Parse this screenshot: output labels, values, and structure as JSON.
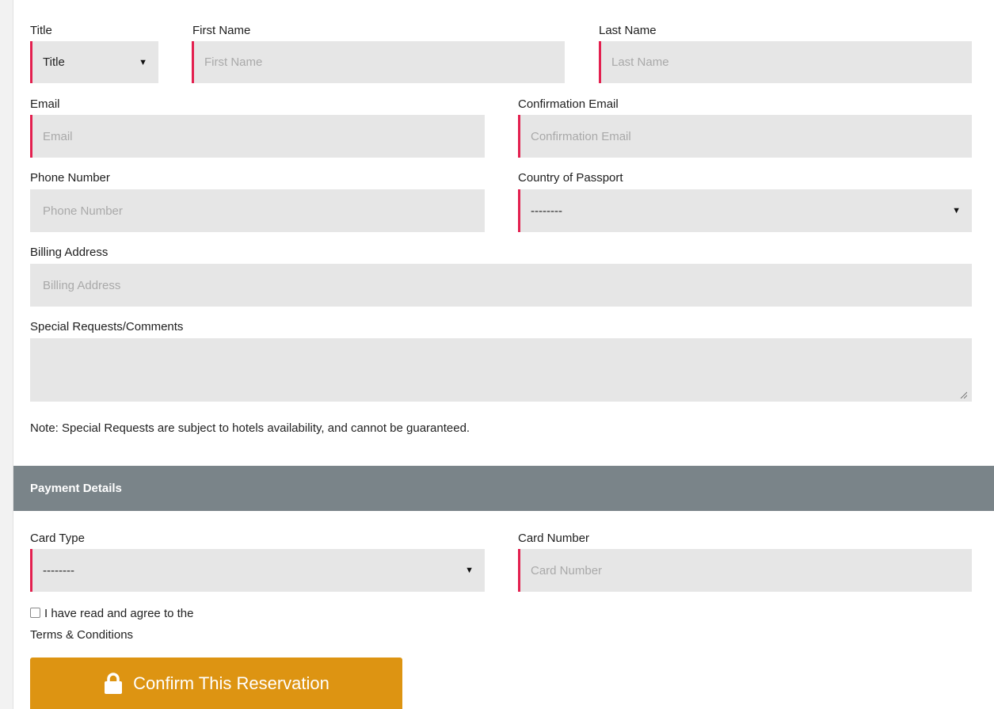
{
  "guest": {
    "title_label": "Title",
    "title_value": "Title",
    "first_name_label": "First Name",
    "first_name_placeholder": "First Name",
    "last_name_label": "Last Name",
    "last_name_placeholder": "Last Name",
    "email_label": "Email",
    "email_placeholder": "Email",
    "confirm_email_label": "Confirmation Email",
    "confirm_email_placeholder": "Confirmation Email",
    "phone_label": "Phone Number",
    "phone_placeholder": "Phone Number",
    "passport_label": "Country of Passport",
    "passport_value": "--------",
    "billing_label": "Billing Address",
    "billing_placeholder": "Billing Address",
    "requests_label": "Special Requests/Comments",
    "requests_value": "",
    "note": "Note: Special Requests are subject to hotels availability, and cannot be guaranteed."
  },
  "payment": {
    "section_title": "Payment Details",
    "card_type_label": "Card Type",
    "card_type_value": "--------",
    "card_number_label": "Card Number",
    "card_number_placeholder": "Card Number"
  },
  "terms": {
    "line1": "I have read and agree to the",
    "line2": "Terms & Conditions",
    "checked": false
  },
  "submit": {
    "label": "Confirm This Reservation",
    "icon": "lock-icon"
  },
  "colors": {
    "required_accent": "#e3204f",
    "field_bg": "#e6e6e6",
    "section_bar": "#7a8489",
    "button": "#dd9412"
  }
}
